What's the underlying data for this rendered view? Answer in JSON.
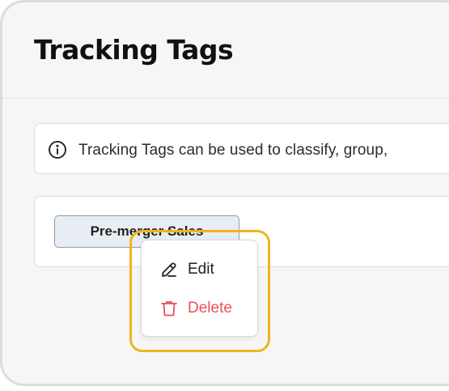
{
  "page": {
    "title": "Tracking Tags"
  },
  "info": {
    "icon": "info-icon",
    "text": "Tracking Tags can be used to classify, group,"
  },
  "tags": [
    {
      "label": "Pre-merger Sales"
    }
  ],
  "context_menu": {
    "items": [
      {
        "label": "Edit",
        "icon": "pencil-icon",
        "color": "#222222"
      },
      {
        "label": "Delete",
        "icon": "trash-icon",
        "color": "#e8505b"
      }
    ],
    "highlight_color": "#f2b31c"
  }
}
